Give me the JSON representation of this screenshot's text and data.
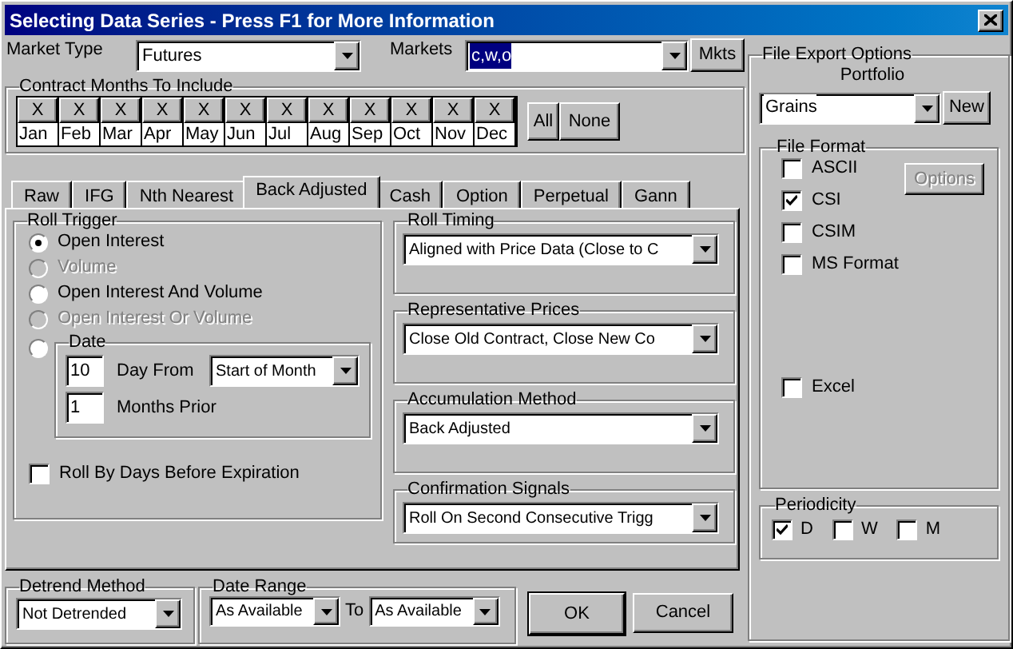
{
  "window": {
    "title": "Selecting Data Series - Press F1 for More Information"
  },
  "market_type": {
    "label": "Market Type",
    "value": "Futures"
  },
  "markets": {
    "label": "Markets",
    "value": "c,w,o",
    "highlighted": true,
    "button": "Mkts"
  },
  "contract_months": {
    "title": "Contract Months To Include",
    "all_button": "All",
    "none_button": "None",
    "months": [
      {
        "label": "Jan",
        "glyph": "X",
        "checked": true
      },
      {
        "label": "Feb",
        "glyph": "X",
        "checked": true
      },
      {
        "label": "Mar",
        "glyph": "X",
        "checked": true
      },
      {
        "label": "Apr",
        "glyph": "X",
        "checked": true
      },
      {
        "label": "May",
        "glyph": "X",
        "checked": true
      },
      {
        "label": "Jun",
        "glyph": "X",
        "checked": true
      },
      {
        "label": "Jul",
        "glyph": "X",
        "checked": true
      },
      {
        "label": "Aug",
        "glyph": "X",
        "checked": true
      },
      {
        "label": "Sep",
        "glyph": "X",
        "checked": true
      },
      {
        "label": "Oct",
        "glyph": "X",
        "checked": true
      },
      {
        "label": "Nov",
        "glyph": "X",
        "checked": true
      },
      {
        "label": "Dec",
        "glyph": "X",
        "checked": true
      }
    ]
  },
  "tabs": [
    {
      "label": "Raw",
      "selected": false
    },
    {
      "label": "IFG",
      "selected": false
    },
    {
      "label": "Nth Nearest",
      "selected": false
    },
    {
      "label": "Back Adjusted",
      "selected": true
    },
    {
      "label": "Cash",
      "selected": false
    },
    {
      "label": "Option",
      "selected": false
    },
    {
      "label": "Perpetual",
      "selected": false
    },
    {
      "label": "Gann",
      "selected": false
    }
  ],
  "roll_trigger": {
    "title": "Roll Trigger",
    "options": [
      {
        "label": "Open Interest",
        "selected": true,
        "disabled": false
      },
      {
        "label": "Volume",
        "selected": false,
        "disabled": true
      },
      {
        "label": "Open Interest And Volume",
        "selected": false,
        "disabled": false
      },
      {
        "label": "Open Interest Or Volume",
        "selected": false,
        "disabled": true
      }
    ],
    "date": {
      "title": "Date",
      "selected": false,
      "day_value": "10",
      "day_label": "Day From",
      "day_from": "Start of Month",
      "months_value": "1",
      "months_label": "Months Prior"
    },
    "roll_by_days": {
      "label": "Roll By Days Before Expiration",
      "checked": false
    }
  },
  "settings": [
    {
      "title": "Roll Timing",
      "value": "Aligned with Price Data (Close to C"
    },
    {
      "title": "Representative Prices",
      "value": "Close Old Contract, Close New Co"
    },
    {
      "title": "Accumulation Method",
      "value": "Back Adjusted"
    },
    {
      "title": "Confirmation Signals",
      "value": "Roll On Second Consecutive Trigg"
    }
  ],
  "detrend": {
    "title": "Detrend Method",
    "value": "Not Detrended"
  },
  "date_range": {
    "title": "Date Range",
    "from": "As Available",
    "to_label": "To",
    "to": "As Available"
  },
  "ok_button": "OK",
  "cancel_button": "Cancel",
  "export": {
    "title": "File Export Options",
    "portfolio_label": "Portfolio",
    "portfolio": "Grains",
    "new_button": "New",
    "file_format": {
      "title": "File Format",
      "options_button": {
        "label": "Options",
        "disabled": true
      },
      "formats": [
        {
          "label": "ASCII",
          "checked": false
        },
        {
          "label": "CSI",
          "checked": true
        },
        {
          "label": "CSIM",
          "checked": false
        },
        {
          "label": "MS Format",
          "checked": false
        }
      ],
      "extra_formats": [
        {
          "label": "Excel",
          "checked": false
        }
      ]
    },
    "periodicity": {
      "title": "Periodicity",
      "options": [
        {
          "label": "D",
          "checked": true
        },
        {
          "label": "W",
          "checked": false
        },
        {
          "label": "M",
          "checked": false
        }
      ]
    }
  }
}
